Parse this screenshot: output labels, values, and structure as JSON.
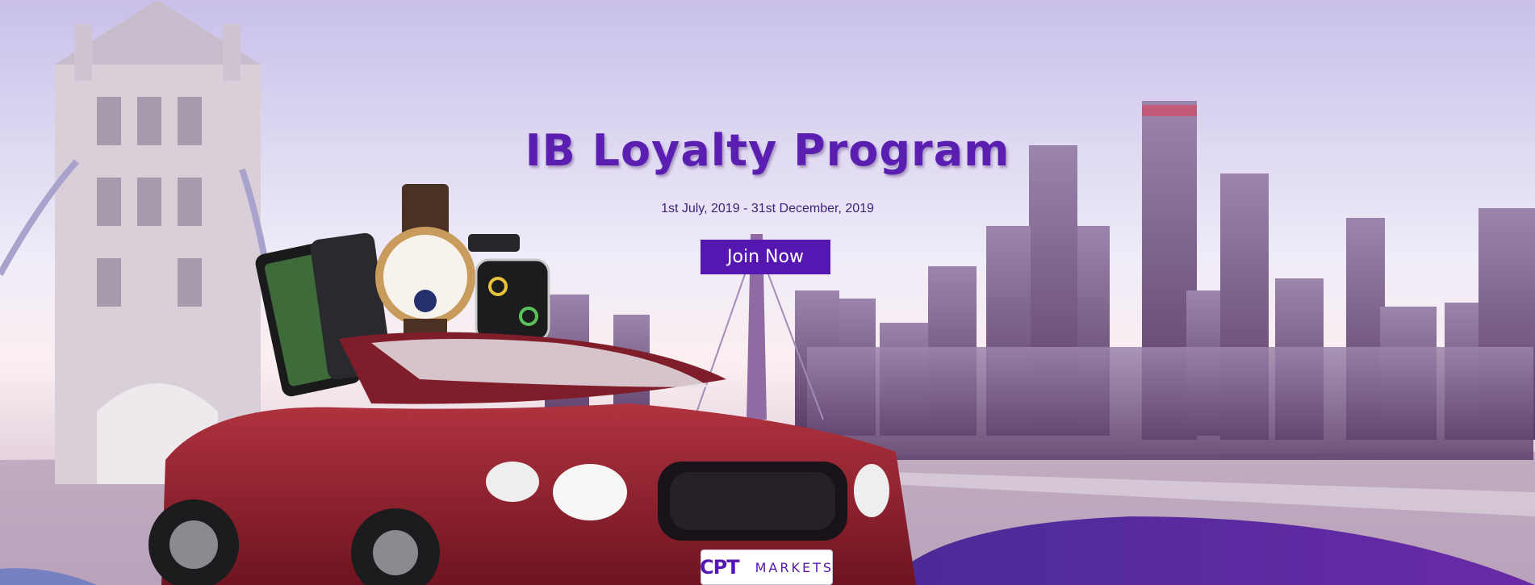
{
  "banner": {
    "title": "IB Loyalty Program",
    "dates": "1st July, 2019 - 31st December, 2019",
    "cta_label": "Join Now",
    "logo": {
      "mark": "CPT",
      "name": "MARKETS"
    }
  },
  "colors": {
    "accent": "#5616b2",
    "title": "#5a1fb1"
  },
  "icons": [
    "tower-bridge-illustration",
    "city-skyline-illustration",
    "smartphone-illustration",
    "watch-illustration",
    "smartwatch-illustration",
    "convertible-car-illustration"
  ]
}
